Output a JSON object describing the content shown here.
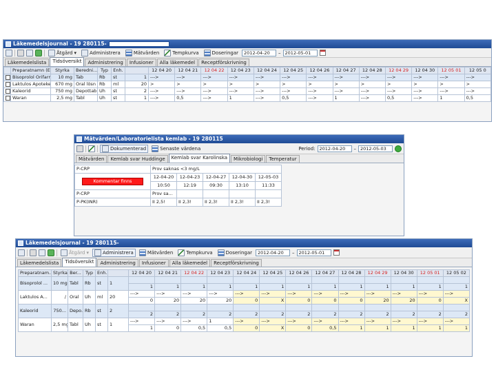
{
  "window1": {
    "title": "Läkemedelsjournal - 19 280115-",
    "toolbar": {
      "atgard": "Åtgärd",
      "administrera": "Administrera",
      "matvarden": "Mätvärden",
      "tempkurva": "Tempkurva",
      "doseringar": "Doseringar",
      "date_from": "2012-04-20",
      "date_to": "2012-05-01"
    },
    "tabs": [
      "Läkemedelslista",
      "Tidsöversikt",
      "Administrering",
      "Infusioner",
      "Alla läkemedel",
      "Receptförskrivning"
    ],
    "columns": [
      "Preparatnamn (Ex.)",
      "Styrka",
      "Beredni...",
      "Typ",
      "Enh.",
      "",
      "12 04 20",
      "12 04 21",
      "12 04 22",
      "12 04 23",
      "12 04 24",
      "12 04 25",
      "12 04 26",
      "12 04 27",
      "12 04 28",
      "12 04 29",
      "12 04 30",
      "12 05 01",
      "12 05 0"
    ],
    "rows": [
      [
        "Bisoprolol Orifarm",
        "10 mg",
        "Tab",
        "Rb",
        "st",
        "1",
        "--->",
        "--->",
        "--->",
        "--->",
        "--->",
        "--->",
        "--->",
        "--->",
        "--->",
        "--->",
        "--->",
        "--->",
        "--->"
      ],
      [
        "Laktulos Apoteket",
        "670 mg",
        "Oral lösn",
        "Rb",
        "ml",
        "20",
        ">",
        ">",
        ">",
        ">",
        ">",
        ">",
        ">",
        ">",
        ">",
        ">",
        ">",
        ">",
        ">"
      ],
      [
        "Kaleorid",
        "750 mg",
        "Depottabl",
        "Uh",
        "st",
        "2",
        "--->",
        "--->",
        "--->",
        "--->",
        "--->",
        "--->",
        "--->",
        "--->",
        "--->",
        "--->",
        "--->",
        "--->",
        "--->"
      ],
      [
        "Waran",
        "2,5 mg",
        "Tabl",
        "Uh",
        "st",
        "1",
        "--->",
        "0,5",
        "--->",
        "1",
        "--->",
        "0,5",
        "--->",
        "1",
        "--->",
        "0,5",
        "--->",
        "1",
        "0,5"
      ]
    ]
  },
  "window2": {
    "title": "Mätvärden/Laboratorielista kemlab - 19 280115",
    "toolbar": {
      "dokumentera": "Dokumenterad",
      "senaste": "Senaste värdena",
      "period_label": "Period:",
      "date_from": "2012-04-20",
      "date_to": "2012-05-03"
    },
    "tabs": [
      "Mätvärden",
      "Kemlab svar Huddinge",
      "Kemlab svar Karolinska",
      "Mikrobiologi",
      "Temperatur"
    ],
    "p_crp": "P-CRP",
    "prov_saknas": "Prov saknas <3 mg/L",
    "dates": [
      "12-04-20",
      "12-04-23",
      "12-04-27",
      "12-04-30",
      "12-05-03"
    ],
    "alarm": "Kommentar finns",
    "times": [
      "10:50",
      "12:19",
      "09:30",
      "13:10",
      "11:33"
    ],
    "row_crp": [
      "P-CRP",
      "Prov sa...",
      "",
      "",
      "",
      ""
    ],
    "row_pk": [
      "P-PK(INR)",
      "II 2,5!",
      "II 2,3!",
      "II 2,3!",
      "II 2,3!",
      "II 2,3!"
    ]
  },
  "window3": {
    "title": "Läkemedelsjournal - 19 280115-",
    "toolbar": {
      "atgard": "Åtgärd",
      "administrera": "Administrera",
      "matvarden": "Mätvärden",
      "tempkurva": "Tempkurva",
      "doseringar": "Doseringar",
      "date_from": "2012-04-20",
      "date_to": "2012-05-01"
    },
    "tabs": [
      "Läkemedelslista",
      "Tidsöversikt",
      "Administrering",
      "Infusioner",
      "Alla läkemedel",
      "Receptförskrivning"
    ],
    "columns": [
      "Preparatnam...",
      "Styrka",
      "Ber...",
      "Typ",
      "Enh.",
      "",
      "12 04 20",
      "12 04 21",
      "12 04 22",
      "12 04 23",
      "12 04 24",
      "12 04 25",
      "12 04 26",
      "12 04 27",
      "12 04 28",
      "12 04 29",
      "12 04 30",
      "12 05 01",
      "12 05 02"
    ],
    "rows": [
      {
        "name": "Bisoprolol ...",
        "styrka": "10 mg",
        "ber": "Tabl",
        "typ": "Rb",
        "enh": "st",
        "dos": "1",
        "top": [
          "",
          "",
          "",
          "",
          "",
          "",
          "",
          "",
          "",
          "",
          "",
          "",
          ""
        ],
        "bottom": [
          "1",
          "1",
          "1",
          "1",
          "1",
          "1",
          "1",
          "1",
          "1",
          "1",
          "1",
          "1",
          "1"
        ]
      },
      {
        "name": "Laktulos A...",
        "styrka": "/",
        "ber": "Oral",
        "typ": "Uh",
        "enh": "ml",
        "dos": "20",
        "top": [
          "--->",
          "--->",
          "--->",
          "--->",
          "--->",
          "--->",
          "--->",
          "--->",
          "--->",
          "--->",
          "--->",
          "--->",
          "--->"
        ],
        "bottom": [
          "0",
          "20",
          "20",
          "20",
          "0",
          "X",
          "0",
          "0",
          "0",
          "20",
          "20",
          "0",
          "X"
        ]
      },
      {
        "name": "Kaleorid",
        "styrka": "750...",
        "ber": "Depo...",
        "typ": "Rb",
        "enh": "st",
        "dos": "2",
        "top": [
          "",
          "",
          "",
          "",
          "",
          "",
          "",
          "",
          "",
          "",
          "",
          "",
          ""
        ],
        "bottom": [
          "2",
          "2",
          "2",
          "2",
          "2",
          "2",
          "2",
          "2",
          "2",
          "2",
          "2",
          "2",
          "2"
        ]
      },
      {
        "name": "Waran",
        "styrka": "2,5 mg",
        "ber": "Tabl",
        "typ": "Uh",
        "enh": "st",
        "dos": "1",
        "top": [
          "--->",
          "--->",
          "--->",
          "1",
          "--->",
          "--->",
          "--->",
          "--->",
          "--->",
          "--->",
          "--->",
          "--->",
          "--->"
        ],
        "bottom": [
          "1",
          "0",
          "0,5",
          "0,5",
          "0",
          "X",
          "0",
          "0,5",
          "1",
          "1",
          "1",
          "1",
          "1"
        ]
      }
    ]
  },
  "colors": {
    "title_bar": "#1f4b95",
    "weekend_red": "#d42020",
    "alarm_red": "#ff1a1a",
    "row_selected": "#dde8f6",
    "cell_yellow": "#fff8d0"
  }
}
